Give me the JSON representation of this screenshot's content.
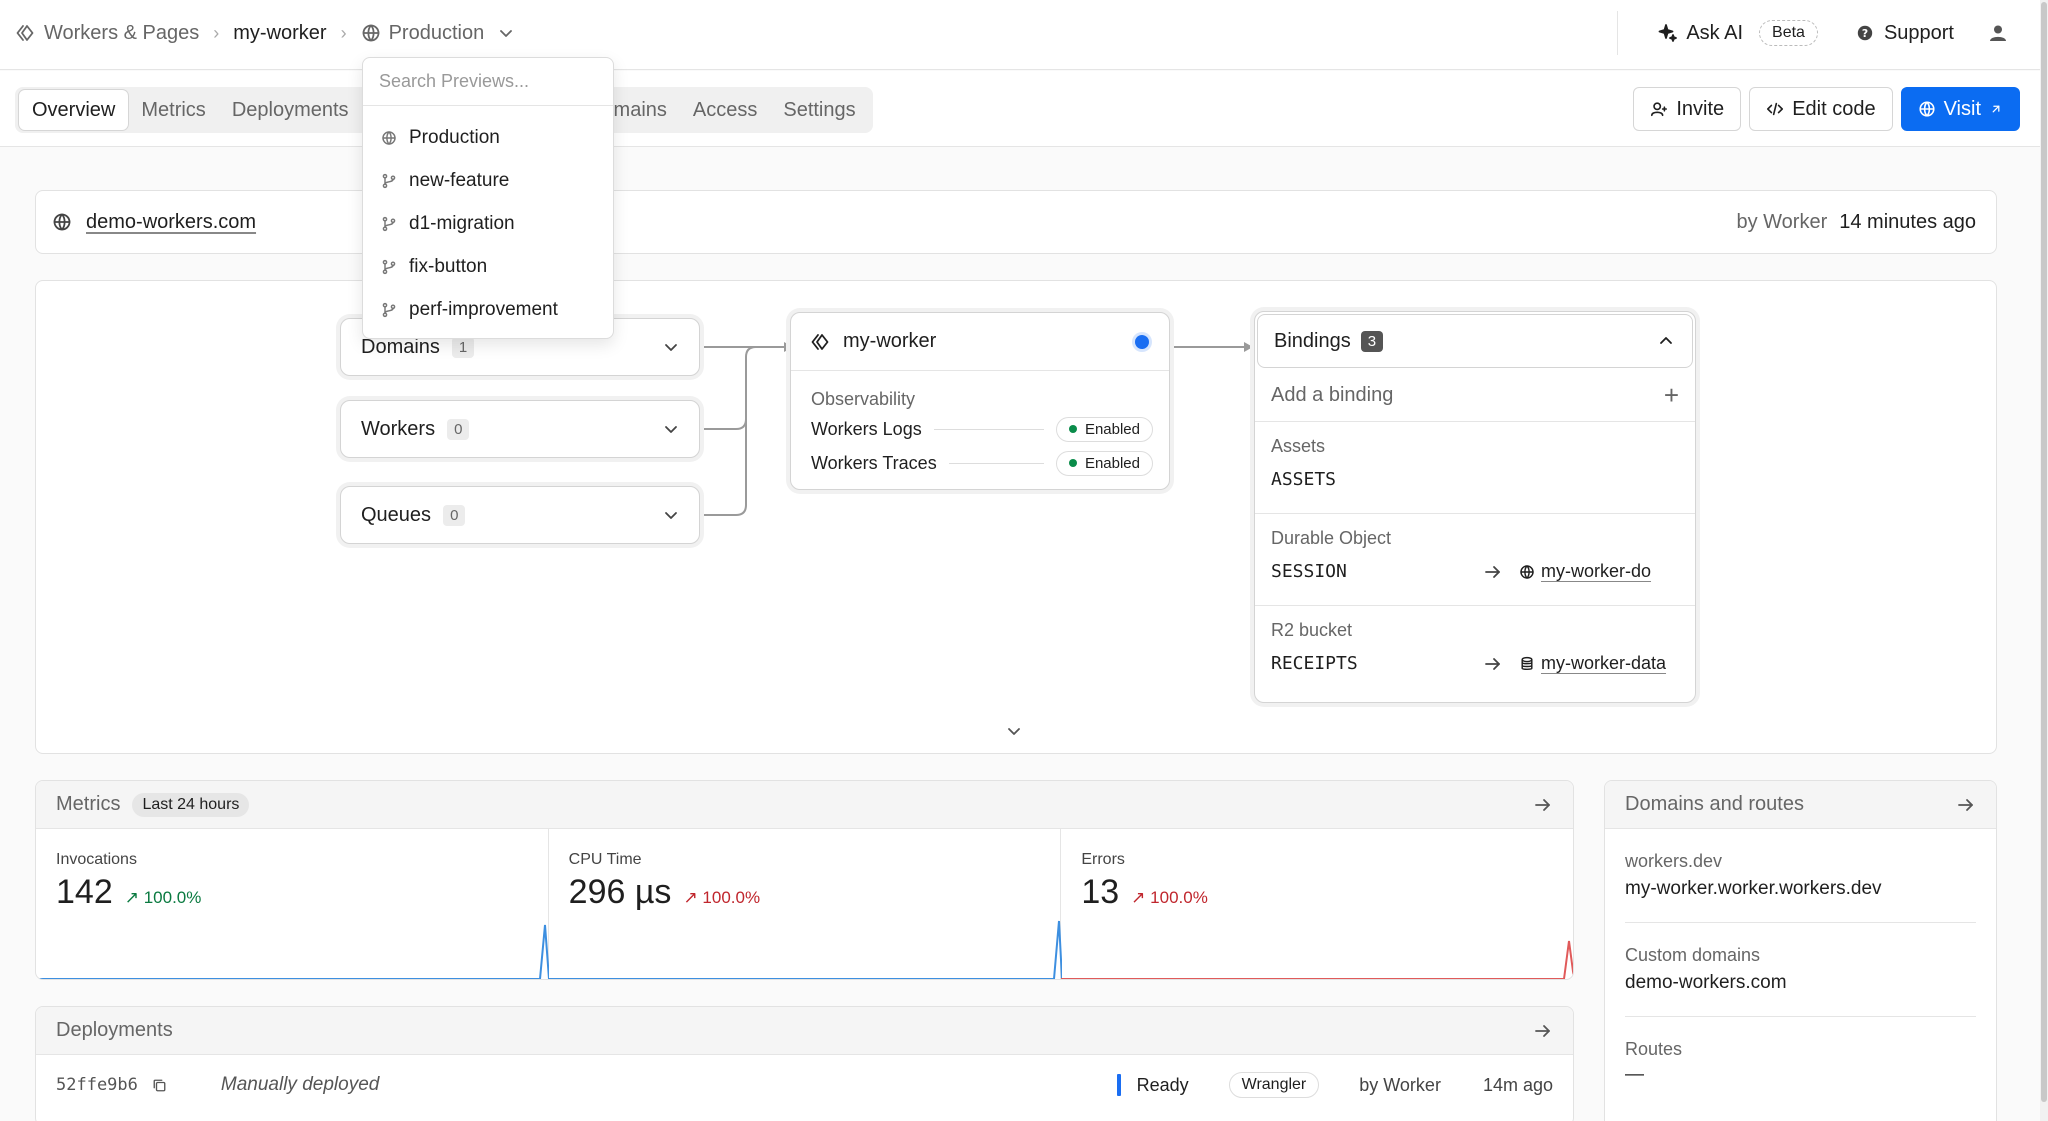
{
  "breadcrumb": {
    "root": "Workers & Pages",
    "worker": "my-worker",
    "environment": "Production"
  },
  "topbar": {
    "ask_ai": "Ask AI",
    "beta": "Beta",
    "support": "Support"
  },
  "tabs": [
    {
      "label": "Overview"
    },
    {
      "label": "Metrics"
    },
    {
      "label": "Deployments"
    },
    {
      "label": "Domains"
    },
    {
      "label": "Access"
    },
    {
      "label": "Settings"
    }
  ],
  "tab_partial": "mains",
  "actions": {
    "invite": "Invite",
    "edit_code": "Edit code",
    "visit": "Visit"
  },
  "domain_strip": {
    "domain": "demo-workers.com",
    "by": "by Worker",
    "time": "14 minutes ago"
  },
  "diagram": {
    "domains": {
      "label": "Domains",
      "count": "1"
    },
    "workers": {
      "label": "Workers",
      "count": "0"
    },
    "queues": {
      "label": "Queues",
      "count": "0"
    },
    "worker": {
      "name": "my-worker",
      "observability_title": "Observability",
      "logs_label": "Workers Logs",
      "logs_status": "Enabled",
      "traces_label": "Workers Traces",
      "traces_status": "Enabled"
    },
    "bindings": {
      "title": "Bindings",
      "count": "3",
      "add_label": "Add a binding",
      "sections": [
        {
          "type": "Assets",
          "name": "ASSETS",
          "target": ""
        },
        {
          "type": "Durable Object",
          "name": "SESSION",
          "target": "my-worker-do"
        },
        {
          "type": "R2 bucket",
          "name": "RECEIPTS",
          "target": "my-worker-data"
        }
      ]
    }
  },
  "metrics": {
    "title": "Metrics",
    "range": "Last 24 hours",
    "items": [
      {
        "label": "Invocations",
        "value": "142",
        "delta": "100.0%",
        "color": "#3d8fe0"
      },
      {
        "label": "CPU Time",
        "value": "296 µs",
        "delta": "100.0%",
        "color": "#3d8fe0"
      },
      {
        "label": "Errors",
        "value": "13",
        "delta": "100.0%",
        "color": "#e05a5a"
      }
    ]
  },
  "deployments": {
    "title": "Deployments",
    "rows": [
      {
        "sha": "52ffe9b6",
        "message": "Manually deployed",
        "status": "Ready",
        "source": "Wrangler",
        "by": "by Worker",
        "ago": "14m ago"
      }
    ]
  },
  "routes": {
    "title": "Domains and routes",
    "workers_dev_label": "workers.dev",
    "workers_dev_value": "my-worker.worker.workers.dev",
    "custom_label": "Custom domains",
    "custom_value": "demo-workers.com",
    "routes_label": "Routes",
    "routes_value": "—"
  },
  "env_dropdown": {
    "search_placeholder": "Search Previews...",
    "items": [
      {
        "label": "Production",
        "icon": "globe-icon"
      },
      {
        "label": "new-feature",
        "icon": "git-branch-icon"
      },
      {
        "label": "d1-migration",
        "icon": "git-branch-icon"
      },
      {
        "label": "fix-button",
        "icon": "git-branch-icon"
      },
      {
        "label": "perf-improvement",
        "icon": "git-branch-icon"
      }
    ]
  },
  "colors": {
    "accent": "#0b6cf2",
    "success": "#0a8c4a",
    "error": "#c0262d"
  }
}
